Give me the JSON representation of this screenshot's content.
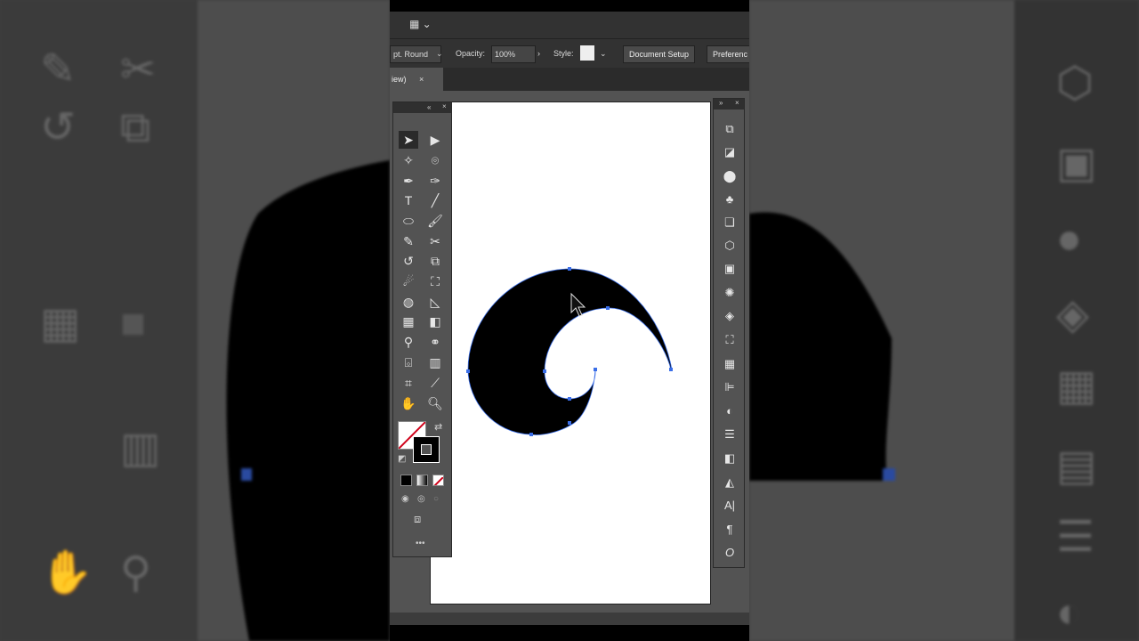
{
  "control_bar": {
    "stroke_profile": "pt. Round",
    "opacity_label": "Opacity:",
    "opacity_value": "100%",
    "style_label": "Style:",
    "document_setup": "Document Setup",
    "preferences": "Preferenc"
  },
  "tab": {
    "title": "iew)",
    "close": "×"
  },
  "tools": [
    {
      "name": "selection-tool",
      "icon": "selection-arrow"
    },
    {
      "name": "direct-selection-tool",
      "icon": "direct-selection-arrow"
    },
    {
      "name": "magic-wand-tool",
      "icon": "magic-wand"
    },
    {
      "name": "lasso-tool",
      "icon": "lasso"
    },
    {
      "name": "pen-tool",
      "icon": "pen"
    },
    {
      "name": "curvature-tool",
      "icon": "curvature-pen"
    },
    {
      "name": "type-tool",
      "icon": "type-T"
    },
    {
      "name": "line-segment-tool",
      "icon": "line"
    },
    {
      "name": "ellipse-tool",
      "icon": "ellipse"
    },
    {
      "name": "paintbrush-tool",
      "icon": "brush"
    },
    {
      "name": "shaper-tool",
      "icon": "shaper"
    },
    {
      "name": "scissors-tool",
      "icon": "scissors"
    },
    {
      "name": "rotate-tool",
      "icon": "rotate"
    },
    {
      "name": "scale-tool",
      "icon": "scale"
    },
    {
      "name": "warp-tool",
      "icon": "warp"
    },
    {
      "name": "free-transform-tool",
      "icon": "free-transform"
    },
    {
      "name": "shape-builder-tool",
      "icon": "shape-builder"
    },
    {
      "name": "perspective-grid-tool",
      "icon": "perspective-grid"
    },
    {
      "name": "mesh-tool",
      "icon": "mesh"
    },
    {
      "name": "gradient-tool",
      "icon": "gradient"
    },
    {
      "name": "eyedropper-tool",
      "icon": "eyedropper"
    },
    {
      "name": "blend-tool",
      "icon": "blend"
    },
    {
      "name": "symbol-sprayer-tool",
      "icon": "symbol-sprayer"
    },
    {
      "name": "column-graph-tool",
      "icon": "column-graph"
    },
    {
      "name": "artboard-tool",
      "icon": "artboard"
    },
    {
      "name": "slice-tool",
      "icon": "knife"
    },
    {
      "name": "hand-tool",
      "icon": "hand"
    },
    {
      "name": "zoom-tool",
      "icon": "magnifier"
    }
  ],
  "right_panel": {
    "icons": [
      "transform-icon",
      "pathfinder-icon",
      "shapes-icon",
      "symbols-icon",
      "libraries-icon",
      "3d-icon",
      "swatch-book-icon",
      "appearance-icon",
      "layers-icon",
      "artboards-icon",
      "grid-icon",
      "align-icon",
      "color-icon",
      "stroke-icon",
      "gradient-icon",
      "transparency-icon",
      "character-icon",
      "paragraph-icon",
      "opentype-icon"
    ]
  },
  "colors": {
    "ui_dark": "#323232",
    "ui_mid": "#535353",
    "artboard": "#ffffff",
    "shape_fill": "#000000",
    "anchor": "#3a6ee8"
  },
  "more_tools": "•••"
}
